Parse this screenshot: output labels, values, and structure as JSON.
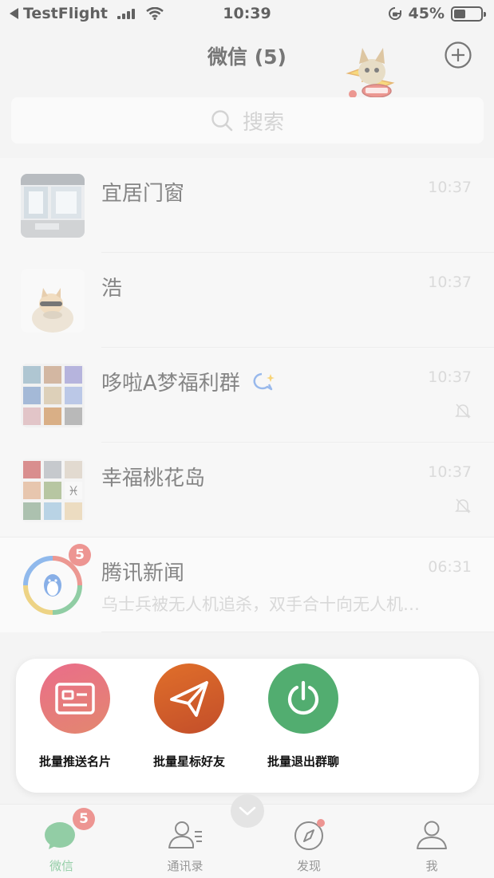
{
  "status_bar": {
    "back_app": "TestFlight",
    "time": "10:39",
    "battery_percent": "45%",
    "battery_level": 0.45
  },
  "nav": {
    "title": "微信 (5)"
  },
  "search": {
    "placeholder": "搜索"
  },
  "chats": [
    {
      "name": "宜居门窗",
      "time": "10:37",
      "preview": "",
      "muted": false
    },
    {
      "name": "浩",
      "time": "10:37",
      "preview": "",
      "muted": false
    },
    {
      "name": "哆啦A梦福利群",
      "time": "10:37",
      "preview": "",
      "muted": true
    },
    {
      "name": "幸福桃花岛",
      "time": "10:37",
      "preview": "",
      "muted": true
    },
    {
      "name": "腾讯新闻",
      "time": "06:31",
      "preview": "乌士兵被无人机追杀，双手合十向无人机…",
      "badge": "5",
      "muted": false
    }
  ],
  "popup": {
    "actions": [
      {
        "label": "批量推送名片",
        "icon": "card-icon",
        "color": "#e47b86"
      },
      {
        "label": "批量星标好友",
        "icon": "paper-plane-icon",
        "color": "#d3632a"
      },
      {
        "label": "批量退出群聊",
        "icon": "power-icon",
        "color": "#52ad70"
      }
    ]
  },
  "tabs": [
    {
      "label": "微信",
      "icon": "chat-bubble-icon",
      "badge": "5",
      "active": true
    },
    {
      "label": "通讯录",
      "icon": "contacts-icon",
      "active": false
    },
    {
      "label": "发现",
      "icon": "compass-icon",
      "active": false
    },
    {
      "label": "我",
      "icon": "person-icon",
      "active": false
    }
  ],
  "colors": {
    "accent_green": "#4fae6e",
    "badge_red": "#e25450"
  }
}
